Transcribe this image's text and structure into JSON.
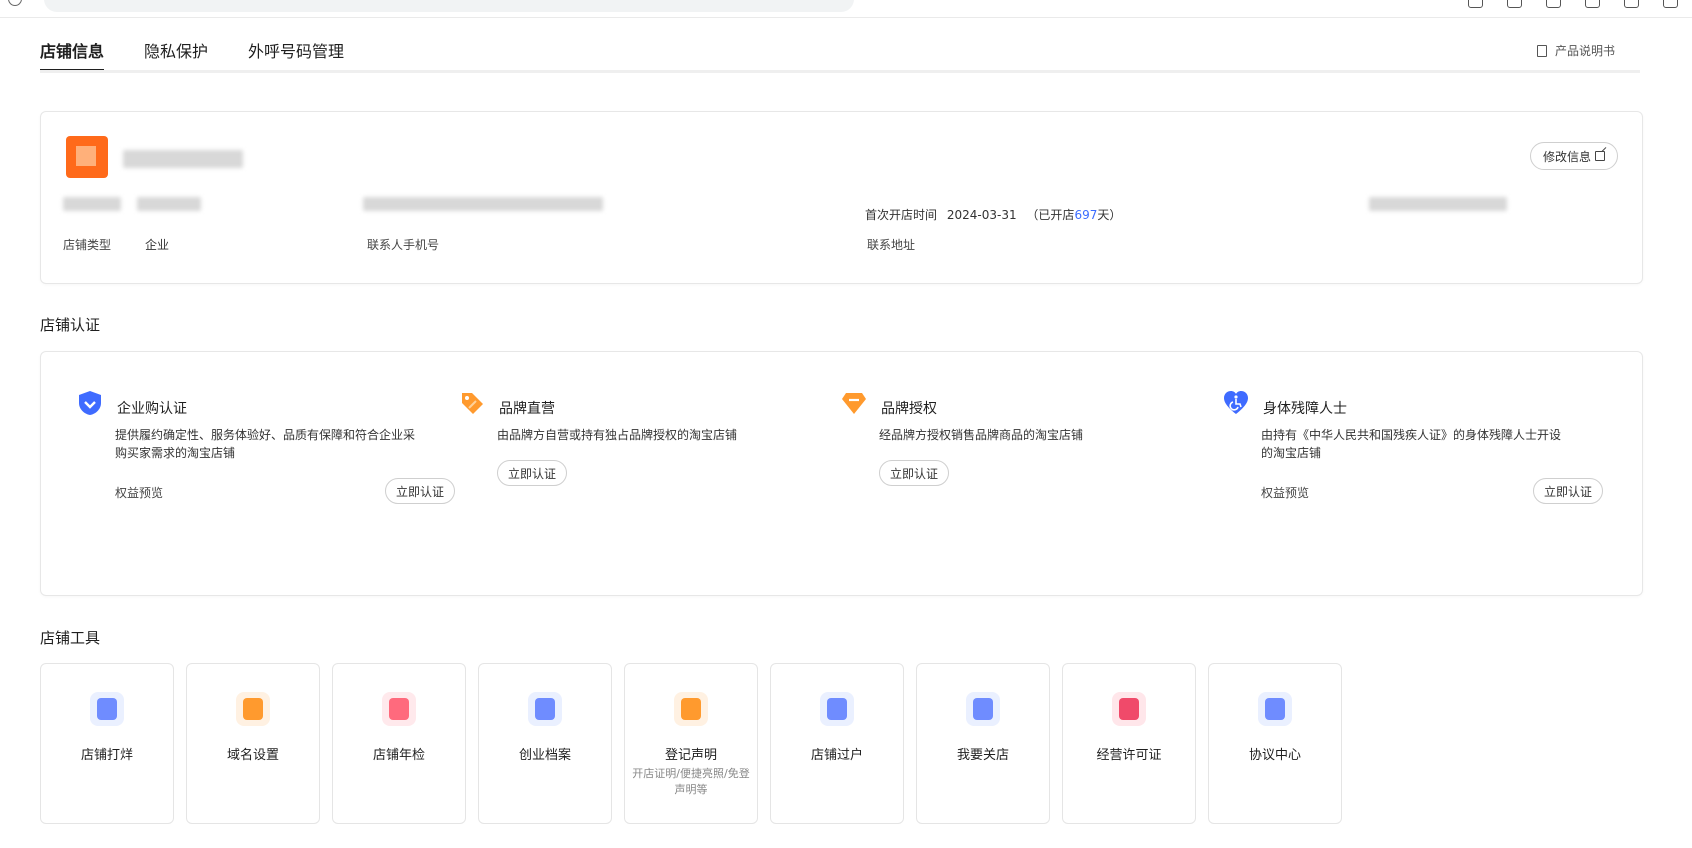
{
  "tabs": [
    {
      "label": "店铺信息",
      "active": true
    },
    {
      "label": "隐私保护",
      "active": false
    },
    {
      "label": "外呼号码管理",
      "active": false
    }
  ],
  "manual_label": "产品说明书",
  "shop_info": {
    "edit_button": "修改信息",
    "shop_type_label": "店铺类型",
    "shop_type_value": "企业",
    "contact_phone_label": "联系人手机号",
    "open_time_label": "首次开店时间",
    "open_time_value": "2024-03-31",
    "open_days_prefix": "（已开店",
    "open_days": "697",
    "open_days_suffix": "天）",
    "contact_address_label": "联系地址"
  },
  "certification": {
    "title": "店铺认证",
    "items": [
      {
        "title": "企业购认证",
        "desc": "提供履约确定性、服务体验好、品质有保障和符合企业采购买家需求的淘宝店铺",
        "benefit": "权益预览",
        "button": "立即认证",
        "icon": "shield-check-icon",
        "color": "#3f6bff"
      },
      {
        "title": "品牌直营",
        "desc": "由品牌方自营或持有独占品牌授权的淘宝店铺",
        "benefit": "",
        "button": "立即认证",
        "icon": "tag-icon",
        "color": "#ff9a2e"
      },
      {
        "title": "品牌授权",
        "desc": "经品牌方授权销售品牌商品的淘宝店铺",
        "benefit": "",
        "button": "立即认证",
        "icon": "diamond-icon",
        "color": "#ff9a2e"
      },
      {
        "title": "身体残障人士",
        "desc": "由持有《中华人民共和国残疾人证》的身体残障人士开设的淘宝店铺",
        "benefit": "权益预览",
        "button": "立即认证",
        "icon": "accessibility-heart-icon",
        "color": "#3f6bff"
      }
    ]
  },
  "tools": {
    "title": "店铺工具",
    "items": [
      {
        "label": "店铺打烊",
        "sub": "",
        "icon": "store-close-icon",
        "tone": "blue"
      },
      {
        "label": "域名设置",
        "sub": "",
        "icon": "domain-icon",
        "tone": "orange"
      },
      {
        "label": "店铺年检",
        "sub": "",
        "icon": "inspection-shield-icon",
        "tone": "red"
      },
      {
        "label": "创业档案",
        "sub": "",
        "icon": "archive-icon",
        "tone": "blue"
      },
      {
        "label": "登记声明",
        "sub": "开店证明/便捷亮照/免登声明等",
        "icon": "registration-icon",
        "tone": "orange"
      },
      {
        "label": "店铺过户",
        "sub": "",
        "icon": "transfer-icon",
        "tone": "blue"
      },
      {
        "label": "我要关店",
        "sub": "",
        "icon": "close-shop-icon",
        "tone": "blue"
      },
      {
        "label": "经营许可证",
        "sub": "",
        "icon": "license-folder-icon",
        "tone": "rose"
      },
      {
        "label": "协议中心",
        "sub": "",
        "icon": "agreement-icon",
        "tone": "blue"
      }
    ]
  }
}
